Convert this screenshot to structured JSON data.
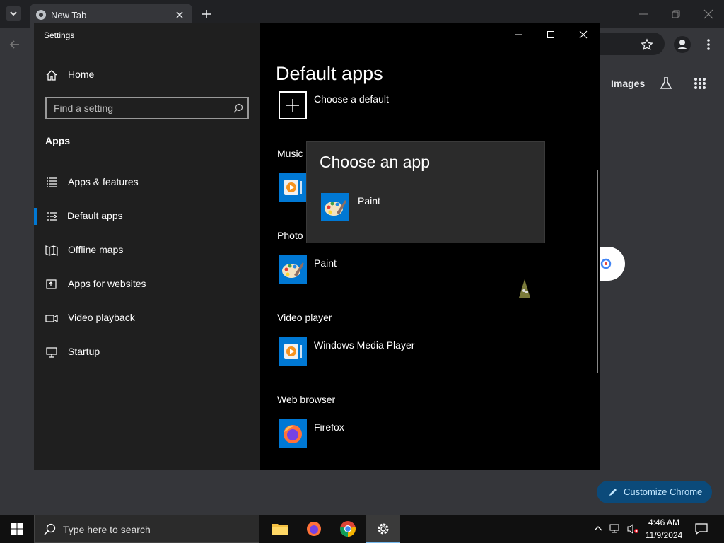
{
  "chrome": {
    "tab_title": "New Tab",
    "images_link": "Images",
    "customize_label": "Customize Chrome"
  },
  "settings": {
    "window_title": "Settings",
    "home_label": "Home",
    "search_placeholder": "Find a setting",
    "section_title": "Apps",
    "nav_items": [
      {
        "label": "Apps & features",
        "icon": "list-icon"
      },
      {
        "label": "Default apps",
        "icon": "default-apps-icon"
      },
      {
        "label": "Offline maps",
        "icon": "map-icon"
      },
      {
        "label": "Apps for websites",
        "icon": "open-external-icon"
      },
      {
        "label": "Video playback",
        "icon": "video-icon"
      },
      {
        "label": "Startup",
        "icon": "monitor-icon"
      }
    ],
    "active_nav": "Default apps",
    "page_title": "Default apps",
    "choose_default": "Choose a default",
    "sections": [
      {
        "label": "Music",
        "app": ""
      },
      {
        "label": "Photo",
        "app": "Paint"
      },
      {
        "label": "Video player",
        "app": "Windows Media Player"
      },
      {
        "label": "Web browser",
        "app": "Firefox"
      }
    ]
  },
  "flyout": {
    "title": "Choose an app",
    "options": [
      {
        "label": "Paint",
        "icon": "paint-icon"
      }
    ]
  },
  "taskbar": {
    "search_placeholder": "Type here to search",
    "time": "4:46 AM",
    "date": "11/9/2024"
  },
  "colors": {
    "accent": "#0078d4",
    "nav_bg": "#1f1f1f",
    "main_bg": "#000000",
    "flyout_bg": "#2b2b2b",
    "chrome_bg": "#35363a",
    "taskbar_bg": "#101010"
  }
}
